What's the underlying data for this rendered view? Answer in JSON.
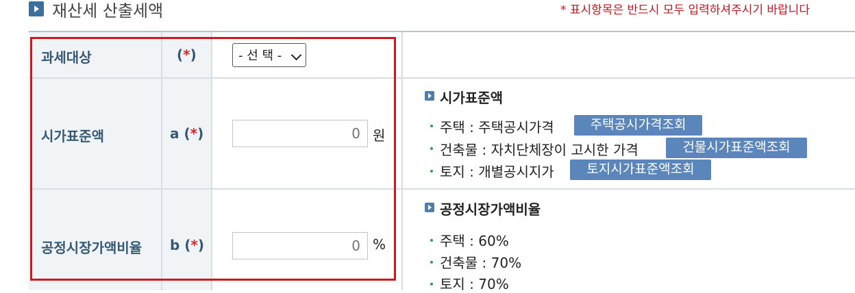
{
  "header": {
    "title": "재산세 산출세액",
    "required_note": "* 표시항목은 반드시 모두 입력하셔주시기 바랍니다"
  },
  "rows": [
    {
      "label": "과세대상",
      "mark_prefix": "",
      "mark_open": "(",
      "mark_star": "*",
      "mark_close": ")"
    },
    {
      "label": "시가표준액",
      "mark_prefix": "a ",
      "mark_open": "(",
      "mark_star": "*",
      "mark_close": ")"
    },
    {
      "label": "공정시장가액비율",
      "mark_prefix": "b ",
      "mark_open": "(",
      "mark_star": "*",
      "mark_close": ")"
    }
  ],
  "controls": {
    "select_value": "- 선 택 -",
    "standard_value_placeholder": "0",
    "standard_value_unit": "원",
    "ratio_placeholder": "0",
    "ratio_unit": "%"
  },
  "info": {
    "standard": {
      "title": "시가표준액",
      "items": [
        {
          "text": "주택 : 주택공시가격",
          "button": "주택공시가격조회"
        },
        {
          "text": "건축물 : 자치단체장이 고시한 가격",
          "button": "건물시가표준액조회"
        },
        {
          "text": "토지 : 개별공시지가",
          "button": "토지시가표준액조회"
        }
      ]
    },
    "ratio": {
      "title": "공정시장가액비율",
      "items": [
        "주택 : 60%",
        "건축물 : 70%",
        "토지 : 70%"
      ]
    }
  },
  "colors": {
    "accent": "#5b86bb",
    "label": "#355874",
    "required": "#d2161e",
    "highlight_box": "#d2161e"
  }
}
